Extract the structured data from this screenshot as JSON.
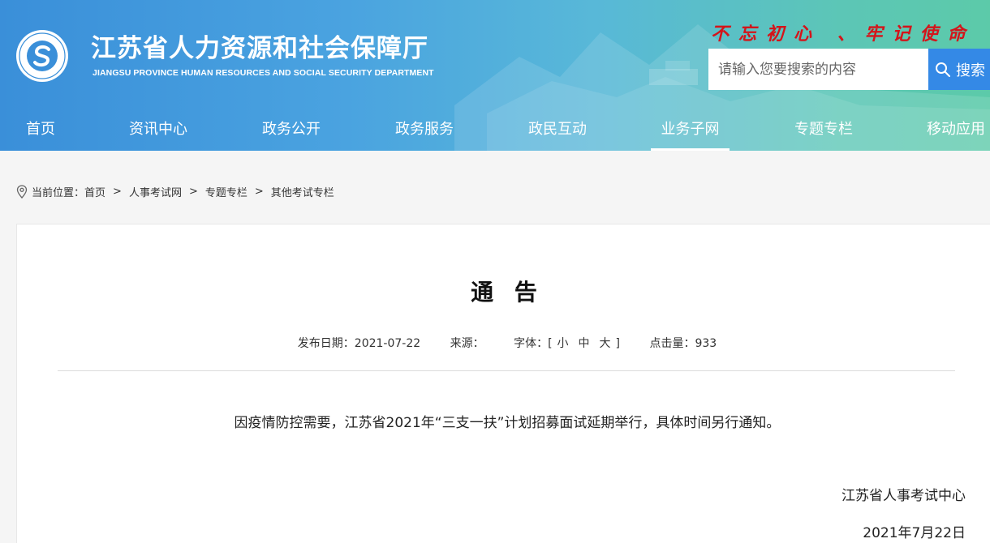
{
  "header": {
    "title": "江苏省人力资源和社会保障厅",
    "subtitle": "JIANGSU PROVINCE HUMAN RESOURCES AND SOCIAL SECURITY DEPARTMENT",
    "slogan": "不忘初心 、牢记使命",
    "search": {
      "placeholder": "请输入您要搜索的内容",
      "button_label": "搜索"
    }
  },
  "nav": {
    "items": [
      {
        "label": "首页"
      },
      {
        "label": "资讯中心"
      },
      {
        "label": "政务公开"
      },
      {
        "label": "政务服务"
      },
      {
        "label": "政民互动"
      },
      {
        "label": "业务子网"
      },
      {
        "label": "专题专栏"
      },
      {
        "label": "移动应用"
      }
    ],
    "active": "业务子网"
  },
  "breadcrumb": {
    "prefix": "当前位置：",
    "items": [
      "首页",
      "人事考试网",
      "专题专栏",
      "其他考试专栏"
    ],
    "separator": ">"
  },
  "article": {
    "title": "通 告",
    "meta": {
      "date_label": "发布日期：",
      "date": "2021-07-22",
      "source_label": "来源：",
      "source": "",
      "font_label": "字体：[",
      "font_small": "小",
      "font_medium": "中",
      "font_large": "大",
      "font_close": "]",
      "views_label": "点击量：",
      "views": "933"
    },
    "body": "因疫情防控需要，江苏省2021年“三支一扶”计划招募面试延期举行，具体时间另行通知。",
    "signature": "江苏省人事考试中心",
    "signature_date": "2021年7月22日"
  },
  "colors": {
    "header_start": "#3a8fd9",
    "header_end": "#5ccaa9",
    "slogan": "#d4141a",
    "search_button": "#3489e6"
  },
  "icons": {
    "logo": "hrss-logo-icon",
    "search": "search-icon",
    "location": "location-pin-icon"
  }
}
